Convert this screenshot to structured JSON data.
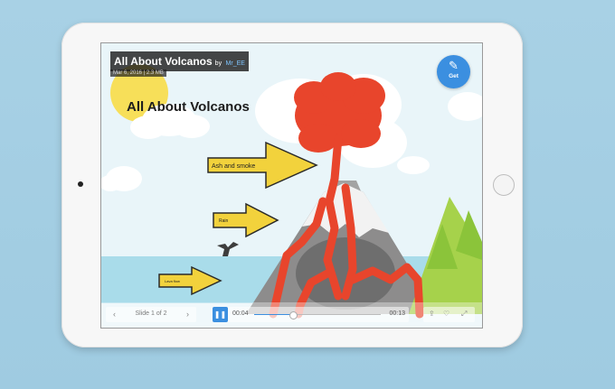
{
  "document": {
    "title": "All About Volcanos",
    "by": "by",
    "author": "Mr_EE",
    "meta": "Mar 6, 2016  |  2.3 MB"
  },
  "slide": {
    "heading": "All About Volcanos",
    "labels": {
      "ash": "Ash and smoke",
      "rain": "Rain",
      "lava": "Lava flow"
    }
  },
  "get_button": {
    "label": "Get",
    "icon": "edit-icon"
  },
  "navigation": {
    "prev_icon": "‹",
    "next_icon": "›",
    "counter": "Slide 1 of 2"
  },
  "player": {
    "pause_icon": "❚❚",
    "current_time": "00:04",
    "total_time": "00:13",
    "progress": 0.31
  },
  "actions": {
    "share_icon": "share-icon",
    "like_icon": "heart-icon",
    "fullscreen_icon": "expand-icon"
  },
  "colors": {
    "accent": "#3b8fe0",
    "lava": "#e8452c",
    "arrow": "#f2d23c",
    "sea": "#a9dcea",
    "mountain": "#8d8c8c"
  }
}
